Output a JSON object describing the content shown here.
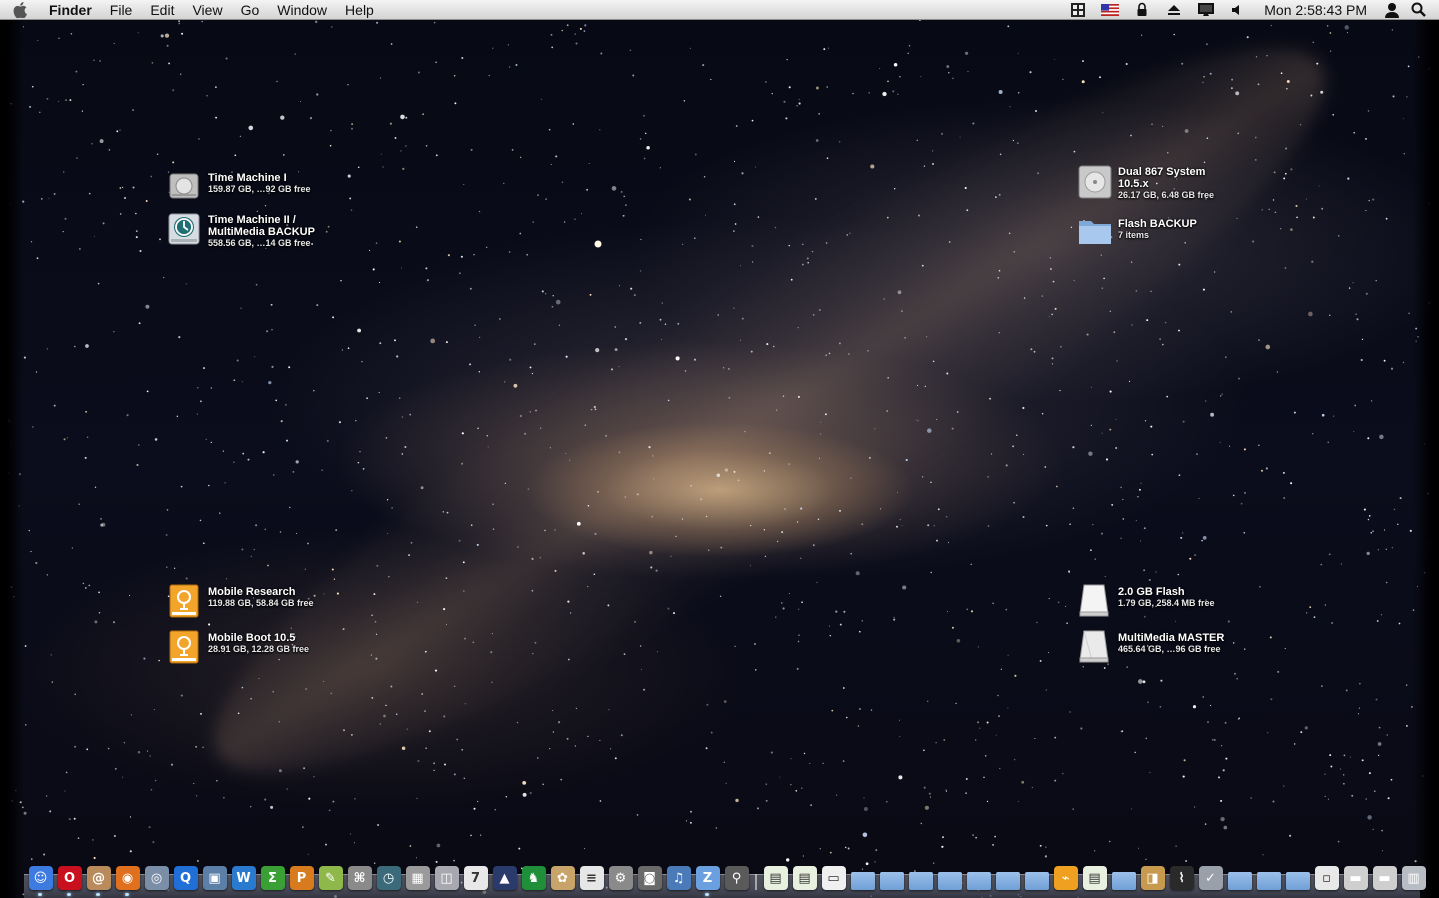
{
  "menubar": {
    "apple_menu": "apple-icon",
    "app_name": "Finder",
    "menus": [
      "File",
      "Edit",
      "View",
      "Go",
      "Window",
      "Help"
    ],
    "extras": [
      "spaces-icon",
      "input-flag-us-icon",
      "lock-icon",
      "eject-icon",
      "display-icon",
      "volume-icon"
    ],
    "clock": "Mon 2:58:43 PM",
    "user_icon": "user-icon",
    "spotlight_icon": "spotlight-search-icon"
  },
  "desktop": {
    "wallpaper": "milky-way-starfield",
    "icons": [
      {
        "id": "time-machine-1",
        "name": "Time Machine I",
        "info": "159.87 GB, …92 GB free",
        "kind": "hd-grey"
      },
      {
        "id": "time-machine-2",
        "name": "Time Machine II /\nMultiMedia BACKUP",
        "info": "558.56 GB, …14 GB free",
        "kind": "time-machine"
      },
      {
        "id": "dual-867-system",
        "name": "Dual 867 System\n10.5.x",
        "info": "26.17 GB, 6.48 GB free",
        "kind": "hd-internal"
      },
      {
        "id": "flash-backup",
        "name": "Flash BACKUP",
        "info": "7 items",
        "kind": "folder"
      },
      {
        "id": "mobile-research",
        "name": "Mobile Research",
        "info": "119.88 GB, 58.84 GB free",
        "kind": "firewire"
      },
      {
        "id": "mobile-boot",
        "name": "Mobile Boot 10.5",
        "info": "28.91 GB, 12.28 GB free",
        "kind": "firewire"
      },
      {
        "id": "flash-2gb",
        "name": "2.0 GB Flash",
        "info": "1.79 GB, 258.4 MB free",
        "kind": "removable"
      },
      {
        "id": "multimedia-master",
        "name": "MultiMedia MASTER",
        "info": "465.64 GB, …96 GB free",
        "kind": "removable"
      }
    ]
  },
  "dock": {
    "apps": [
      {
        "icon": "finder-icon",
        "color": "#3d7be0",
        "glyph": "☺",
        "running": true
      },
      {
        "icon": "opera-icon",
        "color": "#c8101e",
        "glyph": "O",
        "running": true
      },
      {
        "icon": "address-book-icon",
        "color": "#b88a5c",
        "glyph": "@",
        "running": true
      },
      {
        "icon": "firefox-icon",
        "color": "#e0701e",
        "glyph": "◉",
        "running": true
      },
      {
        "icon": "camino-icon",
        "color": "#7a8ea8",
        "glyph": "◎",
        "running": false
      },
      {
        "icon": "quicktime-icon",
        "color": "#1f6fd6",
        "glyph": "Q",
        "running": false
      },
      {
        "icon": "preview-icon",
        "color": "#5c7fa8",
        "glyph": "▣",
        "running": false
      },
      {
        "icon": "textwrangler-icon",
        "color": "#2a7bd0",
        "glyph": "W",
        "running": false
      },
      {
        "icon": "smultron-icon",
        "color": "#3aa035",
        "glyph": "Σ",
        "running": false
      },
      {
        "icon": "pages-icon",
        "color": "#d87b1e",
        "glyph": "P",
        "running": false
      },
      {
        "icon": "scribus-icon",
        "color": "#8fb84a",
        "glyph": "✎",
        "running": false
      },
      {
        "icon": "script-editor-icon",
        "color": "#8a8a8a",
        "glyph": "⌘",
        "running": false
      },
      {
        "icon": "time-machine-app-icon",
        "color": "#3b6a7a",
        "glyph": "◷",
        "running": false
      },
      {
        "icon": "calculator-icon",
        "color": "#9a9a9a",
        "glyph": "▦",
        "running": false
      },
      {
        "icon": "disk-utility-icon",
        "color": "#a8a8b0",
        "glyph": "◫",
        "running": false
      },
      {
        "icon": "ical-icon",
        "color": "#e8e8e8",
        "glyph": "7",
        "running": false
      },
      {
        "icon": "activity-graph-icon",
        "color": "#2a3a6a",
        "glyph": "▲",
        "running": false
      },
      {
        "icon": "chess-icon",
        "color": "#1f8f3a",
        "glyph": "♞",
        "running": false
      },
      {
        "icon": "iphoto-icon",
        "color": "#c9a46a",
        "glyph": "✿",
        "running": false
      },
      {
        "icon": "textedit-icon",
        "color": "#e6e6e6",
        "glyph": "≡",
        "running": false
      },
      {
        "icon": "system-preferences-icon",
        "color": "#8a8a8a",
        "glyph": "⚙",
        "running": false
      },
      {
        "icon": "photo-booth-icon",
        "color": "#6a6a6a",
        "glyph": "◙",
        "running": false
      },
      {
        "icon": "itunes-icon",
        "color": "#4a7ab8",
        "glyph": "♫",
        "running": false
      },
      {
        "icon": "zdnet-icon",
        "color": "#6aa0e0",
        "glyph": "Z",
        "running": true
      },
      {
        "icon": "automator-icon",
        "color": "#5a5a5a",
        "glyph": "⚲",
        "running": false
      }
    ],
    "documents": [
      {
        "icon": "spreadsheet-doc-icon",
        "color": "#e8f0e0",
        "glyph": "▤"
      },
      {
        "icon": "spreadsheet-doc-2-icon",
        "color": "#e8f0e0",
        "glyph": "▤"
      },
      {
        "icon": "document-icon",
        "color": "#f0f0f0",
        "glyph": "▭"
      },
      {
        "icon": "folder-icon",
        "color": "#8fb4e0",
        "glyph": ""
      },
      {
        "icon": "folder-icon",
        "color": "#8fb4e0",
        "glyph": ""
      },
      {
        "icon": "folder-icon",
        "color": "#8fb4e0",
        "glyph": ""
      },
      {
        "icon": "folder-icon",
        "color": "#8fb4e0",
        "glyph": ""
      },
      {
        "icon": "folder-icon",
        "color": "#8fb4e0",
        "glyph": ""
      },
      {
        "icon": "folder-icon",
        "color": "#8fb4e0",
        "glyph": ""
      },
      {
        "icon": "folder-icon",
        "color": "#8fb4e0",
        "glyph": ""
      },
      {
        "icon": "firewire-drive-icon",
        "color": "#f0a020",
        "glyph": "⌁"
      },
      {
        "icon": "spreadsheet-doc-3-icon",
        "color": "#e8f0e0",
        "glyph": "▤"
      },
      {
        "icon": "folder-icon",
        "color": "#8fb4e0",
        "glyph": ""
      },
      {
        "icon": "package-icon",
        "color": "#c89a50",
        "glyph": "◨"
      },
      {
        "icon": "activity-monitor-icon",
        "color": "#2a2a2a",
        "glyph": "⌇"
      },
      {
        "icon": "utility-icon",
        "color": "#9aa0aa",
        "glyph": "✓"
      },
      {
        "icon": "folder-icon",
        "color": "#8fb4e0",
        "glyph": ""
      },
      {
        "icon": "folder-icon",
        "color": "#8fb4e0",
        "glyph": ""
      },
      {
        "icon": "folder-icon",
        "color": "#8fb4e0",
        "glyph": ""
      },
      {
        "icon": "dmg-icon",
        "color": "#e8e8e8",
        "glyph": "▫"
      },
      {
        "icon": "minimized-window-icon",
        "color": "#cfcfcf",
        "glyph": "▬"
      },
      {
        "icon": "minimized-window-2-icon",
        "color": "#cfcfcf",
        "glyph": "▬"
      },
      {
        "icon": "trash-icon",
        "color": "#b8bcc4",
        "glyph": "▥"
      }
    ]
  }
}
